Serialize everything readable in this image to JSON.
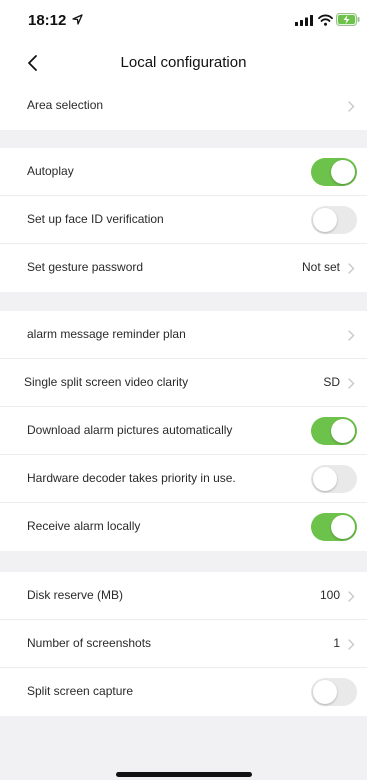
{
  "status": {
    "time": "18:12"
  },
  "nav": {
    "title": "Local configuration"
  },
  "sections": [
    {
      "rows": [
        {
          "label": "Area selection",
          "value": ""
        }
      ]
    },
    {
      "rows": [
        {
          "label": "Autoplay",
          "toggle": true
        },
        {
          "label": "Set up face ID verification",
          "toggle": false
        },
        {
          "label": "Set gesture password",
          "value": "Not set"
        }
      ]
    },
    {
      "rows": [
        {
          "label": "alarm message reminder plan",
          "value": ""
        },
        {
          "label": "Single split screen video clarity",
          "value": "SD"
        },
        {
          "label": "Download alarm pictures automatically",
          "toggle": true
        },
        {
          "label": "Hardware decoder takes priority in use.",
          "toggle": false
        },
        {
          "label": "Receive alarm locally",
          "toggle": true
        }
      ]
    },
    {
      "rows": [
        {
          "label": "Disk reserve (MB)",
          "value": "100"
        },
        {
          "label": "Number of screenshots",
          "value": "1"
        },
        {
          "label": "Split screen capture",
          "toggle": false
        }
      ]
    }
  ],
  "colors": {
    "toggle_on": "#6cc24a",
    "toggle_off": "#e9e9ea",
    "page_background": "#f1f1f3"
  },
  "icons": [
    "location-arrow-icon",
    "signal-icon",
    "wifi-icon",
    "battery-charging-icon",
    "back-chevron-icon",
    "chevron-right-icon"
  ]
}
